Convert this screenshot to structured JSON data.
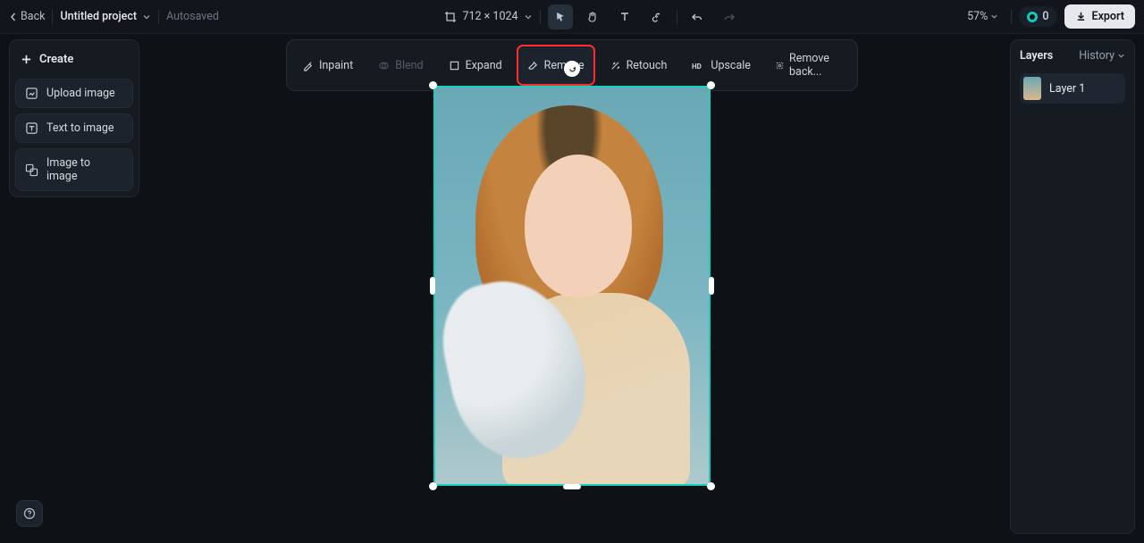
{
  "topbar": {
    "back": "Back",
    "project_name": "Untitled project",
    "autosave": "Autosaved",
    "dimensions": "712 × 1024",
    "zoom": "57%",
    "credits": "0",
    "export": "Export"
  },
  "left": {
    "create": "Create",
    "upload": "Upload image",
    "text2img": "Text to image",
    "img2img": "Image to image"
  },
  "edit_tools": {
    "inpaint": "Inpaint",
    "blend": "Blend",
    "expand": "Expand",
    "remove": "Remove",
    "retouch": "Retouch",
    "upscale": "Upscale",
    "remove_bg": "Remove back..."
  },
  "right": {
    "layers_title": "Layers",
    "history_tab": "History",
    "layer1": "Layer 1"
  }
}
